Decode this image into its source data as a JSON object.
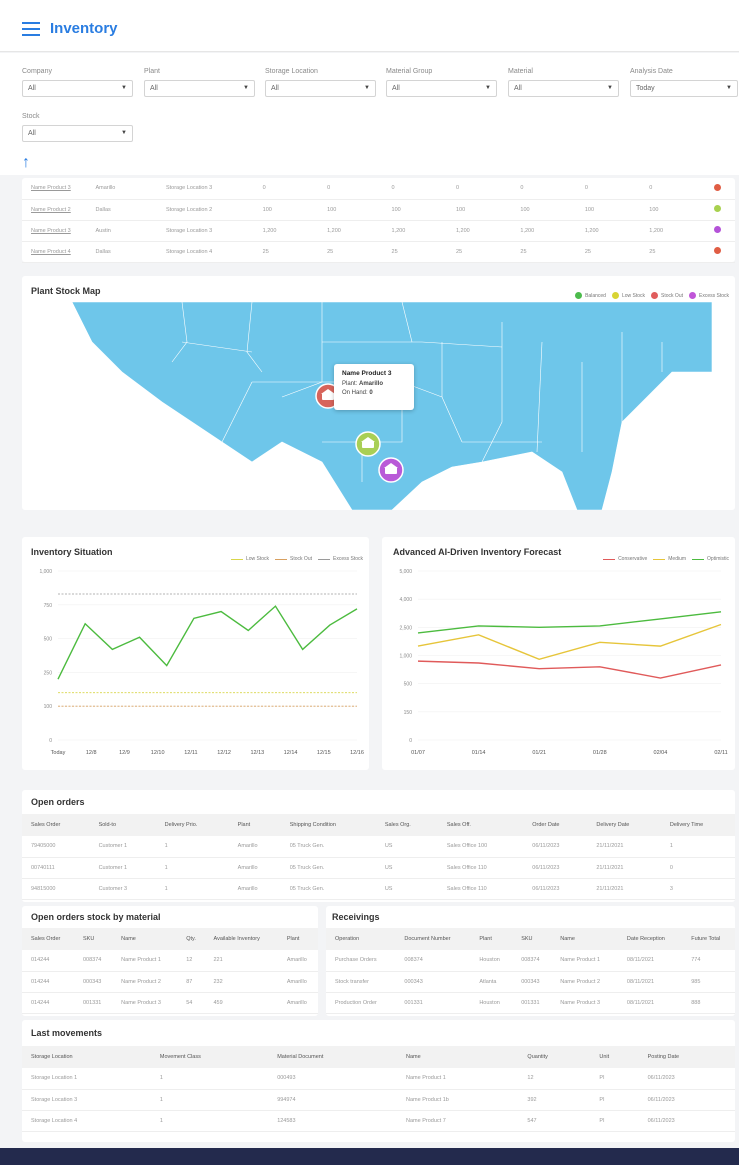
{
  "header": {
    "title": "Inventory"
  },
  "filters": [
    {
      "label": "Company",
      "value": "All"
    },
    {
      "label": "Plant",
      "value": "All"
    },
    {
      "label": "Storage Location",
      "value": "All"
    },
    {
      "label": "Material Group",
      "value": "All"
    },
    {
      "label": "Material",
      "value": "All"
    },
    {
      "label": "Analysis Date",
      "value": "Today"
    },
    {
      "label": "Stock",
      "value": "All"
    }
  ],
  "stock_table": {
    "rows": [
      {
        "name": "Name Product 3",
        "plant": "Amarillo",
        "location": "Storage Location 3",
        "values": [
          "0",
          "0",
          "0",
          "0",
          "0",
          "0",
          "0"
        ],
        "status_color": "#e05d44"
      },
      {
        "name": "Name Product 2",
        "plant": "Dallas",
        "location": "Storage Location 2",
        "values": [
          "100",
          "100",
          "100",
          "100",
          "100",
          "100",
          "100"
        ],
        "status_color": "#a8d14f"
      },
      {
        "name": "Name Product 3",
        "plant": "Austin",
        "location": "Storage Location 3",
        "values": [
          "1,200",
          "1,200",
          "1,200",
          "1,200",
          "1,200",
          "1,200",
          "1,200"
        ],
        "status_color": "#b452d8"
      },
      {
        "name": "Name Product 4",
        "plant": "Dallas",
        "location": "Storage Location 4",
        "values": [
          "25",
          "25",
          "25",
          "25",
          "25",
          "25",
          "25"
        ],
        "status_color": "#e05d44"
      }
    ]
  },
  "map": {
    "title": "Plant Stock Map",
    "legend": [
      {
        "label": "Balanced",
        "color": "#4cbb4c"
      },
      {
        "label": "Low Stock",
        "color": "#d8d434"
      },
      {
        "label": "Stock Out",
        "color": "#e05d5d"
      },
      {
        "label": "Excess Stock",
        "color": "#c056d8"
      }
    ],
    "tooltip": {
      "title": "Name Product 3",
      "plant_label": "Plant:",
      "plant": "Amarillo",
      "onhand_label": "On Hand:",
      "onhand": "0"
    },
    "pins": [
      {
        "name": "pin-amarillo",
        "color": "#d7645b"
      },
      {
        "name": "pin-dallas",
        "color": "#a9cf55"
      },
      {
        "name": "pin-houston",
        "color": "#b95ad8"
      }
    ]
  },
  "chart_data": [
    {
      "type": "line",
      "title": "Inventory Situation",
      "categories": [
        "Today",
        "12/8",
        "12/9",
        "12/10",
        "12/11",
        "12/12",
        "12/13",
        "12/14",
        "12/15",
        "12/16"
      ],
      "ylim": [
        0,
        1000
      ],
      "yticks": [
        "0",
        "100",
        "250",
        "500",
        "750",
        "1,000"
      ],
      "ytick_values": [
        0,
        100,
        250,
        500,
        750,
        1000
      ],
      "series": [
        {
          "name": "Low Stock",
          "color": "#d9d64a",
          "dashed": true,
          "values": [
            160,
            160,
            160,
            160,
            160,
            160,
            160,
            160,
            160,
            160,
            160
          ]
        },
        {
          "name": "Stock Out",
          "color": "#d8a060",
          "dashed": true,
          "values": [
            100,
            100,
            100,
            100,
            100,
            100,
            100,
            100,
            100,
            100,
            100
          ]
        },
        {
          "name": "Excess Stock",
          "color": "#9a9a9a",
          "dashed": true,
          "values": [
            830,
            830,
            830,
            830,
            830,
            830,
            830,
            830,
            830,
            830,
            830
          ]
        },
        {
          "name": "",
          "color": "#4cbb3f",
          "dashed": false,
          "values": [
            220,
            610,
            420,
            510,
            300,
            650,
            700,
            560,
            740,
            420,
            600,
            720
          ]
        }
      ],
      "legend": [
        "Low Stock",
        "Stock Out",
        "Excess Stock"
      ]
    },
    {
      "type": "line",
      "title": "Advanced AI-Driven Inventory Forecast",
      "categories": [
        "01/07",
        "01/14",
        "01/21",
        "01/28",
        "02/04",
        "02/11"
      ],
      "ylim": [
        0,
        5000
      ],
      "yticks": [
        "0",
        "150",
        "500",
        "1,000",
        "2,500",
        "4,000",
        "5,000"
      ],
      "ytick_values": [
        0,
        750,
        1500,
        2250,
        3000,
        4000,
        5000
      ],
      "series": [
        {
          "name": "Conservative",
          "color": "#e05a5a",
          "values": [
            2100,
            2050,
            1900,
            1950,
            1650,
            2000
          ]
        },
        {
          "name": "Medium",
          "color": "#e6c53a",
          "values": [
            2500,
            2800,
            2150,
            2600,
            2500,
            3100
          ]
        },
        {
          "name": "Optimistic",
          "color": "#4cbb3f",
          "values": [
            2850,
            3050,
            3000,
            3050,
            3300,
            3550
          ]
        }
      ],
      "legend": [
        "Conservative",
        "Medium",
        "Optimistic"
      ]
    }
  ],
  "open_orders": {
    "title": "Open orders",
    "columns": [
      "Sales Order",
      "Sold-to",
      "Delivery Prio.",
      "Plant",
      "Shipping Condition",
      "Sales Org.",
      "Sales Off.",
      "Order Date",
      "Delivery Date",
      "Delivery Time"
    ],
    "rows": [
      [
        "79405000",
        "Customer 1",
        "1",
        "Amarillo",
        "05 Truck Gen.",
        "US",
        "Sales Office 100",
        "06/11/2023",
        "21/11/2021",
        "1"
      ],
      [
        "00740111",
        "Customer 1",
        "1",
        "Amarillo",
        "05 Truck Gen.",
        "US",
        "Sales Office 110",
        "06/11/2023",
        "21/11/2021",
        "0"
      ],
      [
        "94815000",
        "Customer 3",
        "1",
        "Amarillo",
        "05 Truck Gen.",
        "US",
        "Sales Office 110",
        "06/11/2023",
        "21/11/2021",
        "3"
      ]
    ]
  },
  "open_orders_material": {
    "title": "Open orders stock by material",
    "columns": [
      "Sales Order",
      "SKU",
      "Name",
      "Qty.",
      "Available Inventory",
      "Plant"
    ],
    "rows": [
      [
        "014244",
        "008374",
        "Name Product 1",
        "12",
        "221",
        "Amarillo"
      ],
      [
        "014244",
        "000343",
        "Name Product 2",
        "87",
        "232",
        "Amarillo"
      ],
      [
        "014244",
        "001331",
        "Name Product 3",
        "54",
        "459",
        "Amarillo"
      ]
    ]
  },
  "receivings": {
    "title": "Receivings",
    "columns": [
      "Operation",
      "Document Number",
      "Plant",
      "SKU",
      "Name",
      "Date Reception",
      "Future Total"
    ],
    "rows": [
      [
        "Purchase Orders",
        "008374",
        "Houston",
        "008374",
        "Name Product 1",
        "08/11/2021",
        "774"
      ],
      [
        "Stock transfer",
        "000343",
        "Atlanta",
        "000343",
        "Name Product 2",
        "08/11/2021",
        "985"
      ],
      [
        "Production Order",
        "001331",
        "Houston",
        "001331",
        "Name Product 3",
        "08/11/2021",
        "888"
      ]
    ]
  },
  "last_movements": {
    "title": "Last movements",
    "columns": [
      "Storage Location",
      "Movement Class",
      "Material Document",
      "Name",
      "Quantity",
      "Unit",
      "Posting Date"
    ],
    "rows": [
      [
        "Storage Location 1",
        "1",
        "000493",
        "Name Product 1",
        "12",
        "PI",
        "06/11/2023"
      ],
      [
        "Storage Location 3",
        "1",
        "994974",
        "Name Product 1b",
        "392",
        "PI",
        "06/11/2023"
      ],
      [
        "Storage Location 4",
        "1",
        "124583",
        "Name Product 7",
        "547",
        "PI",
        "06/11/2023"
      ]
    ]
  }
}
